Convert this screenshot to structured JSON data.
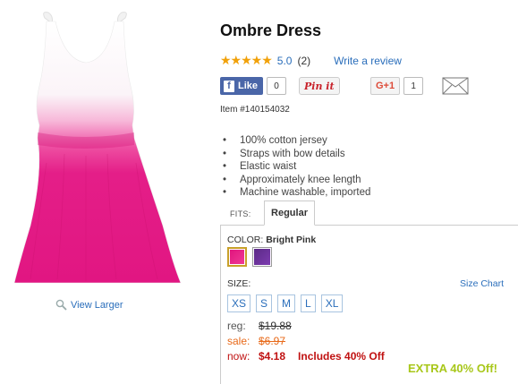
{
  "product": {
    "title": "Ombre Dress",
    "rating_value": "5.0",
    "rating_count": "(2)",
    "write_review": "Write a review",
    "item_number": "Item #140154032",
    "view_larger": "View Larger",
    "image_icon": "dress-image"
  },
  "social": {
    "fb_label": "Like",
    "fb_count": "0",
    "pinit_label": "Pin it",
    "gplus_label": "G+1",
    "gplus_count": "1",
    "mail_icon": "envelope-icon"
  },
  "features": [
    "100% cotton jersey",
    "Straps with bow details",
    "Elastic waist",
    "Approximately knee length",
    "Machine washable, imported"
  ],
  "fits": {
    "label": "FITS:",
    "tab": "Regular"
  },
  "color": {
    "label": "COLOR:",
    "selected": "Bright Pink",
    "swatches": [
      "#e0157e",
      "#6a2f99"
    ]
  },
  "size": {
    "label": "SIZE:",
    "chart_link": "Size Chart",
    "options": [
      "XS",
      "S",
      "M",
      "L",
      "XL"
    ]
  },
  "pricing": {
    "reg_label": "reg:",
    "reg_value": "$19.88",
    "sale_label": "sale:",
    "sale_value": "$6.97",
    "now_label": "now:",
    "now_value": "$4.18",
    "promo": "Includes 40% Off",
    "extra_off": "EXTRA 40% Off!"
  },
  "colors": {
    "link": "#2a6ebb",
    "star": "#f1a10a",
    "price_red": "#c01111",
    "sale_orange": "#e86a1a",
    "extra_green": "#a8c71a",
    "fb_blue": "#4a66a8"
  }
}
